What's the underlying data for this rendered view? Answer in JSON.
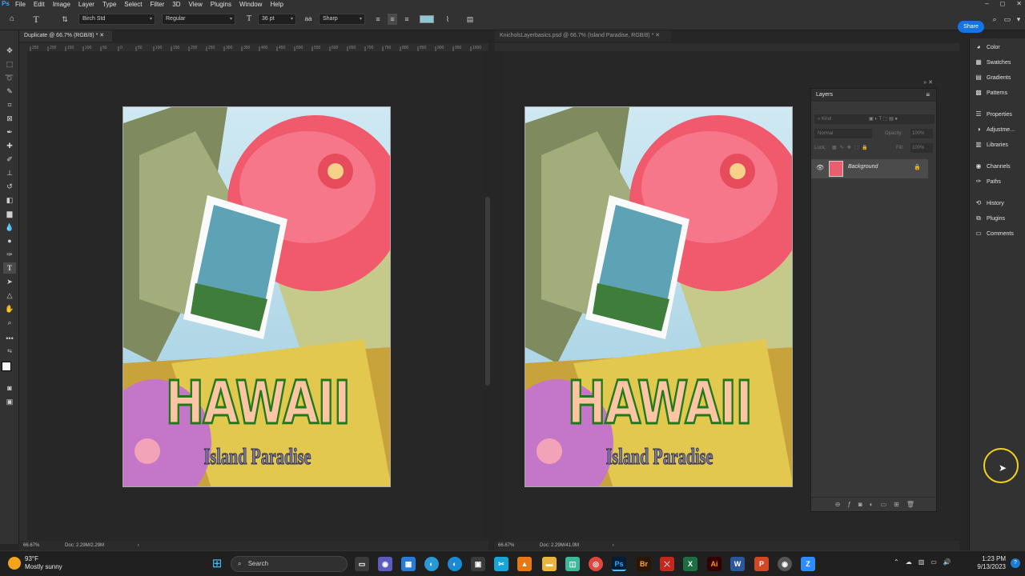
{
  "menu": {
    "items": [
      "File",
      "Edit",
      "Image",
      "Layer",
      "Type",
      "Select",
      "Filter",
      "3D",
      "View",
      "Plugins",
      "Window",
      "Help"
    ]
  },
  "window_controls": [
    "–",
    "◻",
    "✕"
  ],
  "options_bar": {
    "font_family": "Birch Std",
    "font_style": "Regular",
    "font_size": "36 pt",
    "antialias": "Sharp",
    "share_label": "Share"
  },
  "documents": {
    "left": {
      "tab_title": "Duplicate @ 66.7% (RGB/8) *",
      "zoom": "66.67%",
      "doc_size": "Doc: 2.29M/2.29M",
      "ruler_ticks": [
        "250",
        "200",
        "150",
        "100",
        "50",
        "0",
        "50",
        "100",
        "150",
        "200",
        "250",
        "300",
        "350",
        "400",
        "450",
        "500",
        "550",
        "600",
        "650",
        "700",
        "750",
        "800",
        "850",
        "900",
        "950",
        "1000"
      ]
    },
    "right": {
      "tab_title": "KnicholsLayerbasics.psd @ 66.7% (Island Paradise, RGB/8) *",
      "zoom": "66.67%",
      "doc_size": "Doc: 2.29M/41.0M"
    }
  },
  "poster": {
    "title": "HAWAII",
    "subtitle": "Island Paradise"
  },
  "layers_panel": {
    "title": "Layers",
    "filter_placeholder": "Kind",
    "blend_mode": "Normal",
    "opacity_label": "Opacity:",
    "opacity_value": "100%",
    "lock_label": "Lock:",
    "fill_label": "Fill:",
    "fill_value": "100%",
    "layers": [
      {
        "name": "Background",
        "visible": true,
        "locked": true
      }
    ]
  },
  "dock": {
    "groups": [
      [
        {
          "label": "Color",
          "icon": "color-icon"
        },
        {
          "label": "Swatches",
          "icon": "swatches-icon"
        },
        {
          "label": "Gradients",
          "icon": "gradients-icon"
        },
        {
          "label": "Patterns",
          "icon": "patterns-icon"
        }
      ],
      [
        {
          "label": "Properties",
          "icon": "properties-icon"
        },
        {
          "label": "Adjustme...",
          "icon": "adjustments-icon"
        },
        {
          "label": "Libraries",
          "icon": "libraries-icon"
        }
      ],
      [
        {
          "label": "Channels",
          "icon": "channels-icon"
        },
        {
          "label": "Paths",
          "icon": "paths-icon"
        }
      ],
      [
        {
          "label": "History",
          "icon": "history-icon"
        },
        {
          "label": "Plugins",
          "icon": "plugins-icon"
        },
        {
          "label": "Comments",
          "icon": "comments-icon"
        }
      ]
    ]
  },
  "taskbar": {
    "weather_temp": "93°F",
    "weather_desc": "Mostly sunny",
    "search_placeholder": "Search",
    "time": "1:23 PM",
    "date": "9/13/2023",
    "apps": [
      "Ps",
      "Br",
      "Ai",
      "Xl",
      "Ac",
      "W",
      "P",
      "Z"
    ]
  },
  "colors": {
    "accent": "#1473e6",
    "ps_blue": "#31a8ff",
    "cursor_highlight": "#f1d21b"
  }
}
